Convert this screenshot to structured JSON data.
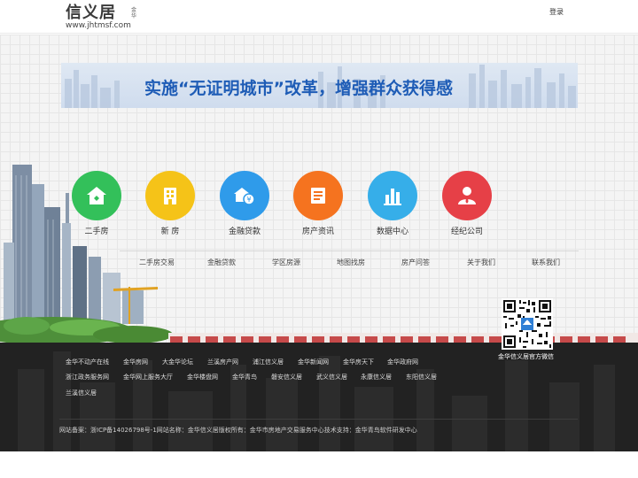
{
  "header": {
    "logo_text": "信义居",
    "logo_city": "金华",
    "logo_url": "www.jhtmsf.com",
    "login_label": "登录"
  },
  "banner": {
    "text": "实施“无证明城市”改革，增强群众获得感"
  },
  "features": [
    {
      "label": "二手房",
      "icon": "house-icon",
      "color": "#33c05a"
    },
    {
      "label": "新 房",
      "icon": "building-icon",
      "color": "#f5c318"
    },
    {
      "label": "金融贷款",
      "icon": "money-house-icon",
      "color": "#2f9bea"
    },
    {
      "label": "房产资讯",
      "icon": "news-icon",
      "color": "#f5731f"
    },
    {
      "label": "数据中心",
      "icon": "bar-chart-icon",
      "color": "#36aee9"
    },
    {
      "label": "经纪公司",
      "icon": "agent-icon",
      "color": "#e64047"
    }
  ],
  "subnav": [
    "二手房交易",
    "金融贷款",
    "学区房源",
    "地图找房",
    "房产问答",
    "关于我们",
    "联系我们"
  ],
  "qr": {
    "caption": "金华信义居官方微信"
  },
  "footer": {
    "links_row1": [
      "金华不动产在线",
      "金华房网",
      "大金华论坛",
      "兰溪房产网",
      "浦江信义居",
      "金华新闻网",
      "金华房天下",
      "金华政府网"
    ],
    "links_row2": [
      "浙江政务服务网",
      "金华网上服务大厅",
      "金华楼盘网",
      "金华青鸟",
      "磐安信义居",
      "武义信义居",
      "永康信义居",
      "东阳信义居"
    ],
    "links_row3": [
      "兰溪信义居"
    ],
    "copyright": "网站备案：浙ICP备14026798号-1网站名称：金华信义居版权所有：金华市房地产交易服务中心技术支持：金华青鸟软件研发中心"
  }
}
